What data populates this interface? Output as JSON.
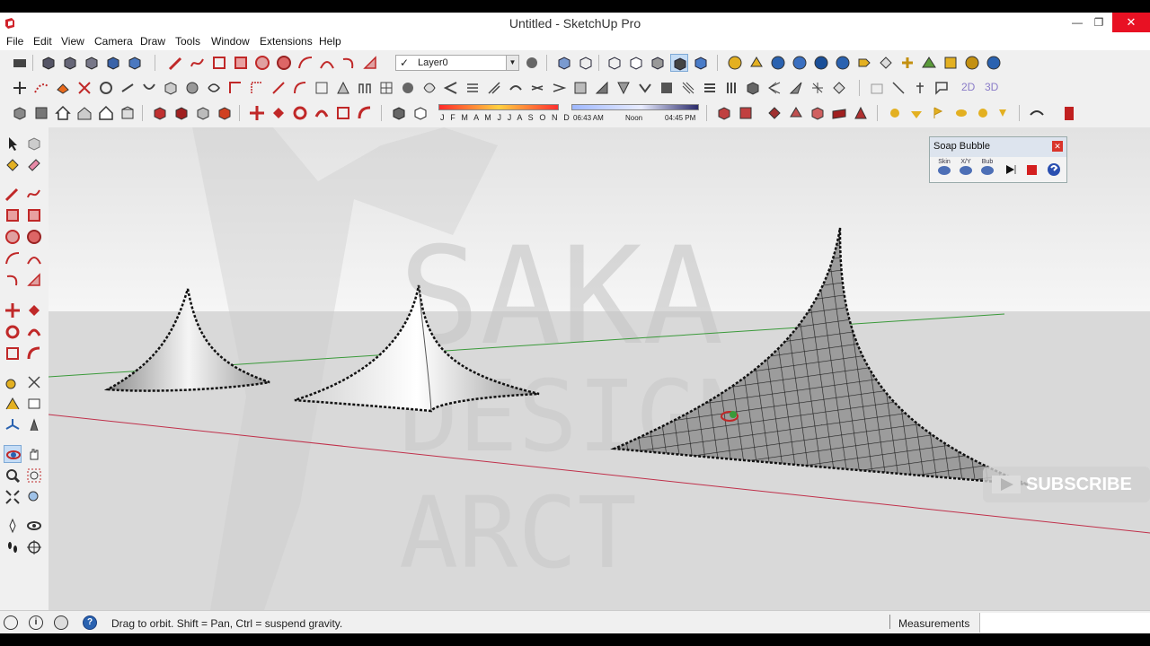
{
  "window": {
    "title": "Untitled - SketchUp Pro",
    "min_glyph": "—",
    "restore_glyph": "❐",
    "close_glyph": "✕"
  },
  "menu": [
    "File",
    "Edit",
    "View",
    "Camera",
    "Draw",
    "Tools",
    "Window",
    "Extensions",
    "Help"
  ],
  "layers": {
    "check_glyph": "✓",
    "current": "Layer0",
    "dropdown_glyph": "▼"
  },
  "shadows": {
    "months": "J F M A M J J A S O N D",
    "time_start": "06:43 AM",
    "time_mid": "Noon",
    "time_end": "04:45 PM"
  },
  "views": {
    "label_2d": "2D",
    "label_3d": "3D"
  },
  "soap_bubble": {
    "title": "Soap Bubble",
    "close_glyph": "✕",
    "buttons": [
      "Skin",
      "X/Y",
      "Bub",
      "",
      "",
      ""
    ]
  },
  "watermark": {
    "line1": "SAKA",
    "line2": "DESIGN",
    "line3": "ARCT",
    "subscribe": "SUBSCRIBE"
  },
  "status": {
    "hint": "Drag to orbit. Shift = Pan, Ctrl = suspend gravity.",
    "measurements_label": "Measurements",
    "measurements_value": "",
    "info_glyph": "i",
    "help_glyph": "?"
  },
  "colors": {
    "accent_blue": "#2a62b0",
    "red_axis": "#c0304a",
    "green_axis": "#3a9a3a",
    "close_red": "#e81123"
  }
}
